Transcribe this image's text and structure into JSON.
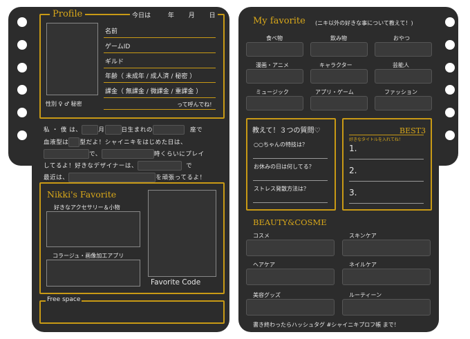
{
  "left": {
    "profile_title": "Profile",
    "date": {
      "today": "今日は",
      "year": "年",
      "month": "月",
      "day": "日"
    },
    "fields": [
      "名前",
      "ゲームID",
      "ギルド",
      "年齢（ 未成年 / 成人済 / 秘密 ）",
      "課金（ 無課金 / 微課金 / 重課金 ）"
    ],
    "gender": "性別  ♀  ♂  秘密",
    "call_me": "って呼んでね!",
    "intro": {
      "l1_a": "私 ・ 僕 は、",
      "l1_b": "月",
      "l1_c": "日生まれの",
      "l1_d": "座で",
      "l2_a": "血液型は",
      "l2_b": "型だよ！シャイニキをはじめた日は、",
      "l3_a": "で、",
      "l3_b": "時くらいにプレイ",
      "l4_a": "してるよ！好きなデザイナーは、",
      "l4_b": "で",
      "l5_a": "最近は、",
      "l5_b": "を頑張ってるよ！"
    },
    "nikki_title": "Nikki's Favorite",
    "accessory_label": "好きなアクセサリー＆小物",
    "collage_label": "コラージュ・画像加工アプリ",
    "favorite_code": "Favorite Code",
    "free_space": "Free space"
  },
  "right": {
    "fav_title": "My favorite",
    "fav_sub": "(ニキ以外の好きな事について教えて！)",
    "fav_items": [
      "食べ物",
      "飲み物",
      "おやつ",
      "漫画・アニメ",
      "キャラクター",
      "芸能人",
      "ミュージック",
      "アプリ・ゲーム",
      "ファッション"
    ],
    "q_title": "教えて！３つの質問♡",
    "questions": [
      "○○ちゃんの特技は？",
      "お休みの日は何してる？",
      "ストレス発散方法は？"
    ],
    "best_title": "BEST3",
    "best_sub": "好きなタイトルを入れてね！",
    "best_nums": [
      "1.",
      "2.",
      "3."
    ],
    "beauty_title": "BEAUTY&COSME",
    "beauty_items": [
      "コスメ",
      "スキンケア",
      "ヘアケア",
      "ネイルケア",
      "美容グッズ",
      "ルーティーン"
    ],
    "footer": "書き終わったらハッシュタグ #シャイニキプロフ帳 まで！"
  },
  "colors": {
    "card": "#2c2c2c",
    "accent": "#d9a81a"
  }
}
